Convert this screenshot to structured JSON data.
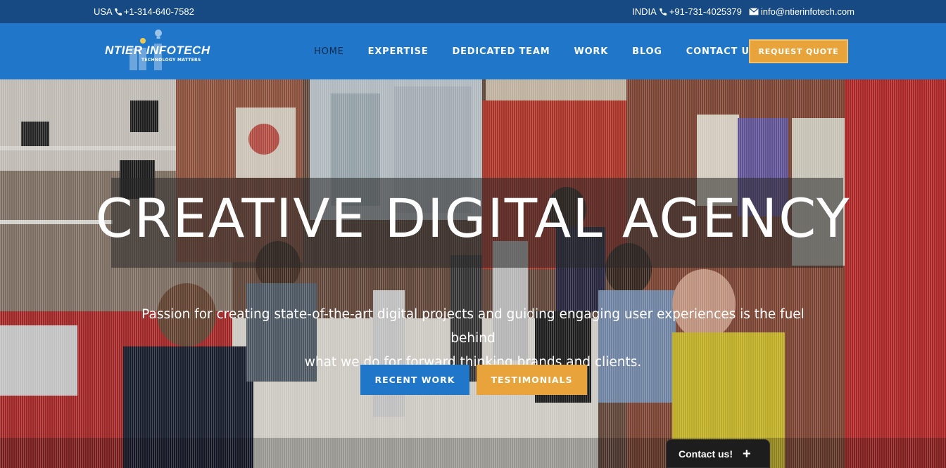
{
  "topbar": {
    "usa_label": "USA",
    "usa_phone": "+1-314-640-7582",
    "india_label": "INDIA",
    "india_phone": "+91-731-4025379",
    "email": "info@ntierinfotech.com"
  },
  "logo": {
    "brand": "NTIER INFOTECH",
    "tagline": "TECHNOLOGY MATTERS"
  },
  "nav": {
    "items": [
      "HOME",
      "EXPERTISE",
      "DEDICATED TEAM",
      "WORK",
      "BLOG",
      "CONTACT US"
    ],
    "active": "HOME"
  },
  "quote_button": "REQUEST QUOTE",
  "hero": {
    "title": "CREATIVE DIGITAL AGENCY",
    "subtitle_line1": "Passion for creating state-of-the-art digital projects and guiding engaging user experiences is the fuel behind",
    "subtitle_line2": "what we do for forward thinking brands and clients.",
    "recent_work_button": "RECENT WORK",
    "testimonials_button": "TESTIMONIALS"
  },
  "contact_widget": {
    "label": "Contact us!",
    "toggle_icon": "plus-icon"
  },
  "colors": {
    "topbar": "#174a82",
    "header": "#2077c9",
    "accent": "#e8a43a",
    "active_nav": "#0d2a4a"
  }
}
